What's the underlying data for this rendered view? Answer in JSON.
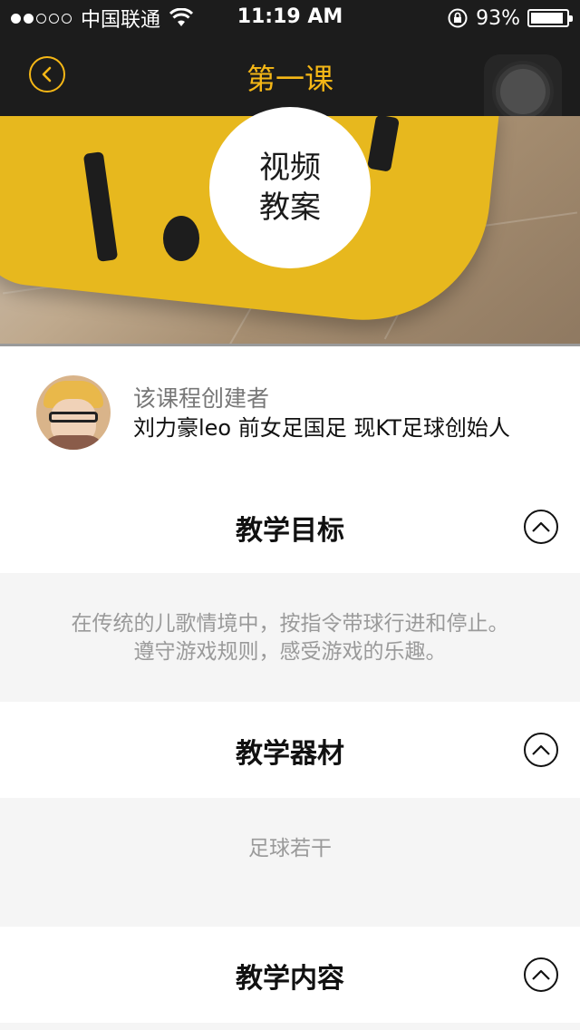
{
  "status": {
    "carrier": "中国联通",
    "time": "11:19 AM",
    "battery": "93%",
    "battery_level": 0.93
  },
  "nav": {
    "title": "第一课",
    "accent": "#f5b716"
  },
  "hero": {
    "badge_line1": "视频",
    "badge_line2": "教案"
  },
  "creator": {
    "label": "该课程创建者",
    "name": "刘力豪leo 前女足国足   现KT足球创始人"
  },
  "sections": [
    {
      "title": "教学目标",
      "lines": [
        "在传统的儿歌情境中，按指令带球行进和停止。",
        "遵守游戏规则，感受游戏的乐趣。"
      ]
    },
    {
      "title": "教学器材",
      "lines": [
        "足球若干"
      ]
    },
    {
      "title": "教学内容",
      "lines": []
    }
  ]
}
